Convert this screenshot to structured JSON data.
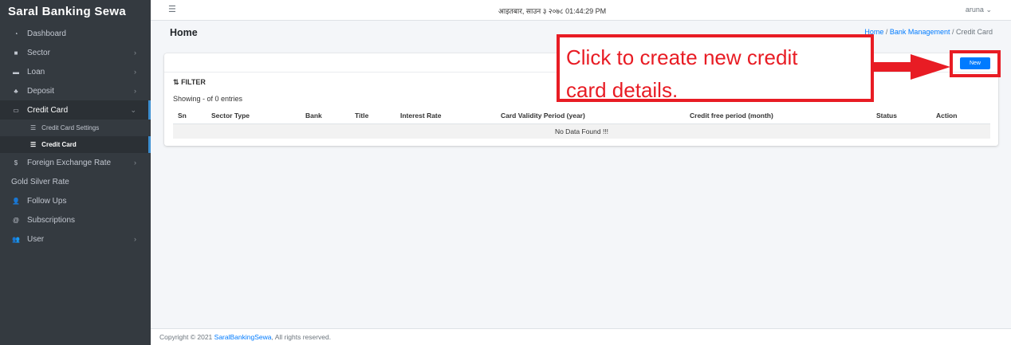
{
  "brand": "Saral Banking Sewa",
  "sidebar": {
    "items": [
      {
        "label": "Dashboard",
        "icon": "dashboard-icon"
      },
      {
        "label": "Sector",
        "icon": "sector-icon"
      },
      {
        "label": "Loan",
        "icon": "loan-icon"
      },
      {
        "label": "Deposit",
        "icon": "deposit-icon"
      },
      {
        "label": "Credit Card",
        "icon": "credit-card-icon"
      },
      {
        "label": "Foreign Exchange Rate",
        "icon": "dollar-icon"
      },
      {
        "label": "Gold Silver Rate"
      },
      {
        "label": "Follow Ups",
        "icon": "user-plus-icon"
      },
      {
        "label": "Subscriptions",
        "icon": "at-icon"
      },
      {
        "label": "User",
        "icon": "users-icon"
      }
    ],
    "credit_card_sub": [
      {
        "label": "Credit Card Settings"
      },
      {
        "label": "Credit Card"
      }
    ]
  },
  "topbar": {
    "datetime": "आइतबार, साउन ३ २०७८ 01:44:29 PM",
    "user": "aruna"
  },
  "header": {
    "title": "Home",
    "breadcrumb": [
      "Home",
      "Bank Management",
      "Credit Card"
    ]
  },
  "card": {
    "new_label": "New",
    "filter_label": "FILTER",
    "showing": "Showing - of 0 entries",
    "columns": [
      "Sn",
      "Sector Type",
      "Bank",
      "Title",
      "Interest Rate",
      "Card Validity Period (year)",
      "Credit free period (month)",
      "Status",
      "Action"
    ],
    "empty": "No Data Found !!!"
  },
  "annotation": {
    "line1": "Click to create new credit",
    "line2": "card details."
  },
  "footer": {
    "prefix": "Copyright © 2021",
    "link": "SaralBankingSewa",
    "suffix": ", All rights reserved."
  },
  "colors": {
    "sidebar_bg": "#343a40",
    "primary": "#007bff",
    "annotation": "#e81c24"
  }
}
